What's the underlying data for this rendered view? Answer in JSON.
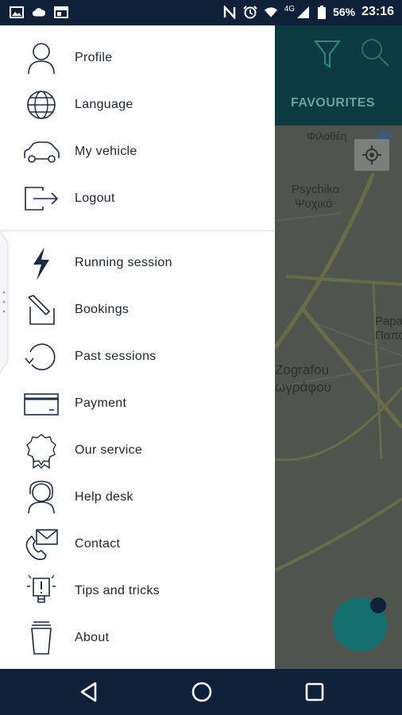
{
  "status_bar": {
    "battery": "56%",
    "network": "4G",
    "time": "23:16",
    "icons": [
      "image-icon",
      "cloud-icon",
      "window-icon",
      "nfc-icon",
      "alarm-icon",
      "wifi-icon",
      "signal-icon",
      "battery-icon"
    ]
  },
  "app": {
    "tab_label": "FAVOURITES",
    "header_icons": [
      "filter-icon",
      "search-icon"
    ],
    "map_labels": {
      "filothei": "Φιλοθέη",
      "psychiko_en": "Psychiko",
      "psychiko_gr": "Ψυχικό",
      "zografou_en": "Zografou",
      "zografou_gr": "ωγράφου",
      "papagou_en": "Papa",
      "papagou_gr": "Παπα"
    }
  },
  "drawer": {
    "account_items": [
      {
        "label": "Profile",
        "icon": "profile-icon"
      },
      {
        "label": "Language",
        "icon": "globe-icon"
      },
      {
        "label": "My vehicle",
        "icon": "car-icon"
      },
      {
        "label": "Logout",
        "icon": "logout-icon"
      }
    ],
    "main_items": [
      {
        "label": "Running session",
        "icon": "lightning-icon"
      },
      {
        "label": "Bookings",
        "icon": "booking-icon"
      },
      {
        "label": "Past sessions",
        "icon": "history-icon"
      },
      {
        "label": "Payment",
        "icon": "card-icon"
      },
      {
        "label": "Our service",
        "icon": "badge-icon"
      },
      {
        "label": "Help desk",
        "icon": "helpdesk-icon"
      },
      {
        "label": "Contact",
        "icon": "contact-icon"
      },
      {
        "label": "Tips and tricks",
        "icon": "lightbulb-icon"
      },
      {
        "label": "About",
        "icon": "cup-icon"
      }
    ]
  },
  "colors": {
    "navy": "#0f2138",
    "teal": "#14706e",
    "drawer_bg": "#ffffff",
    "icon_stroke": "#1c2a44"
  }
}
